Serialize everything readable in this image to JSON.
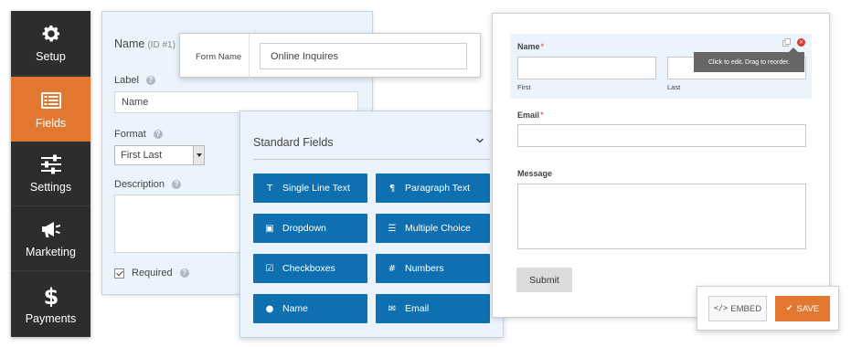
{
  "sidebar": {
    "items": [
      {
        "label": "Setup",
        "icon": "gear-icon"
      },
      {
        "label": "Fields",
        "icon": "list-icon",
        "active": true
      },
      {
        "label": "Settings",
        "icon": "sliders-icon"
      },
      {
        "label": "Marketing",
        "icon": "megaphone-icon"
      },
      {
        "label": "Payments",
        "icon": "dollar-icon"
      }
    ]
  },
  "field_options": {
    "title": "Name",
    "id_text": "(ID #1)",
    "label_label": "Label",
    "label_value": "Name",
    "format_label": "Format",
    "format_value": "First Last",
    "description_label": "Description",
    "required_label": "Required",
    "required_checked": true
  },
  "form_name": {
    "label": "Form Name",
    "value": "Online Inquires"
  },
  "standard_fields": {
    "title": "Standard Fields",
    "buttons": [
      {
        "label": "Single Line Text",
        "icon": "text-icon"
      },
      {
        "label": "Paragraph Text",
        "icon": "paragraph-icon"
      },
      {
        "label": "Dropdown",
        "icon": "dropdown-icon"
      },
      {
        "label": "Multiple Choice",
        "icon": "list-icon"
      },
      {
        "label": "Checkboxes",
        "icon": "checkbox-icon"
      },
      {
        "label": "Numbers",
        "icon": "hash-icon"
      },
      {
        "label": "Name",
        "icon": "user-icon"
      },
      {
        "label": "Email",
        "icon": "envelope-icon"
      }
    ]
  },
  "preview": {
    "name_label": "Name",
    "first_label": "First",
    "last_label": "Last",
    "email_label": "Email",
    "message_label": "Message",
    "required_mark": "*",
    "submit_label": "Submit",
    "tooltip": "Click to edit. Drag to reorder."
  },
  "actions": {
    "embed_label": "EMBED",
    "embed_icon": "</>",
    "save_label": "SAVE",
    "save_icon": "✔"
  },
  "colors": {
    "sidebar_bg": "#2d2d2d",
    "accent_orange": "#e27730",
    "field_button_blue": "#0e70b0",
    "panel_bg": "#ebf3fc",
    "required_red": "#d63638"
  }
}
